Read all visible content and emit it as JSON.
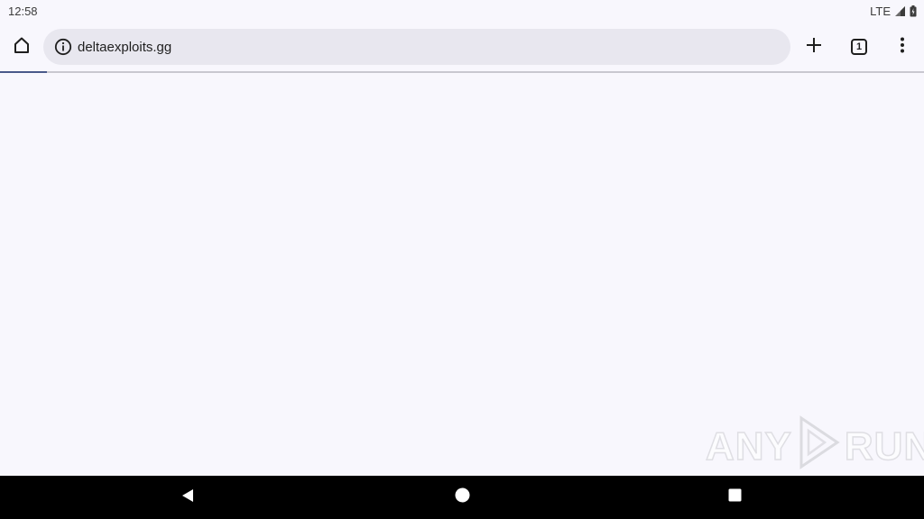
{
  "status_bar": {
    "time": "12:58",
    "network": "LTE"
  },
  "toolbar": {
    "url": "deltaexploits.gg",
    "tab_count": "1"
  },
  "icons": {
    "home": "home-icon",
    "info": "info-icon",
    "new_tab": "plus-icon",
    "tabs": "tab-switcher-icon",
    "menu": "more-vert-icon",
    "signal": "signal-icon",
    "battery": "battery-icon",
    "back": "back-icon",
    "nav_home": "home-circle-icon",
    "recents": "recents-icon"
  },
  "watermark": {
    "left": "ANY",
    "right": "RUN"
  },
  "colors": {
    "background": "#f8f7fd",
    "omnibox": "#e8e7ef",
    "nav_bar": "#000000"
  }
}
